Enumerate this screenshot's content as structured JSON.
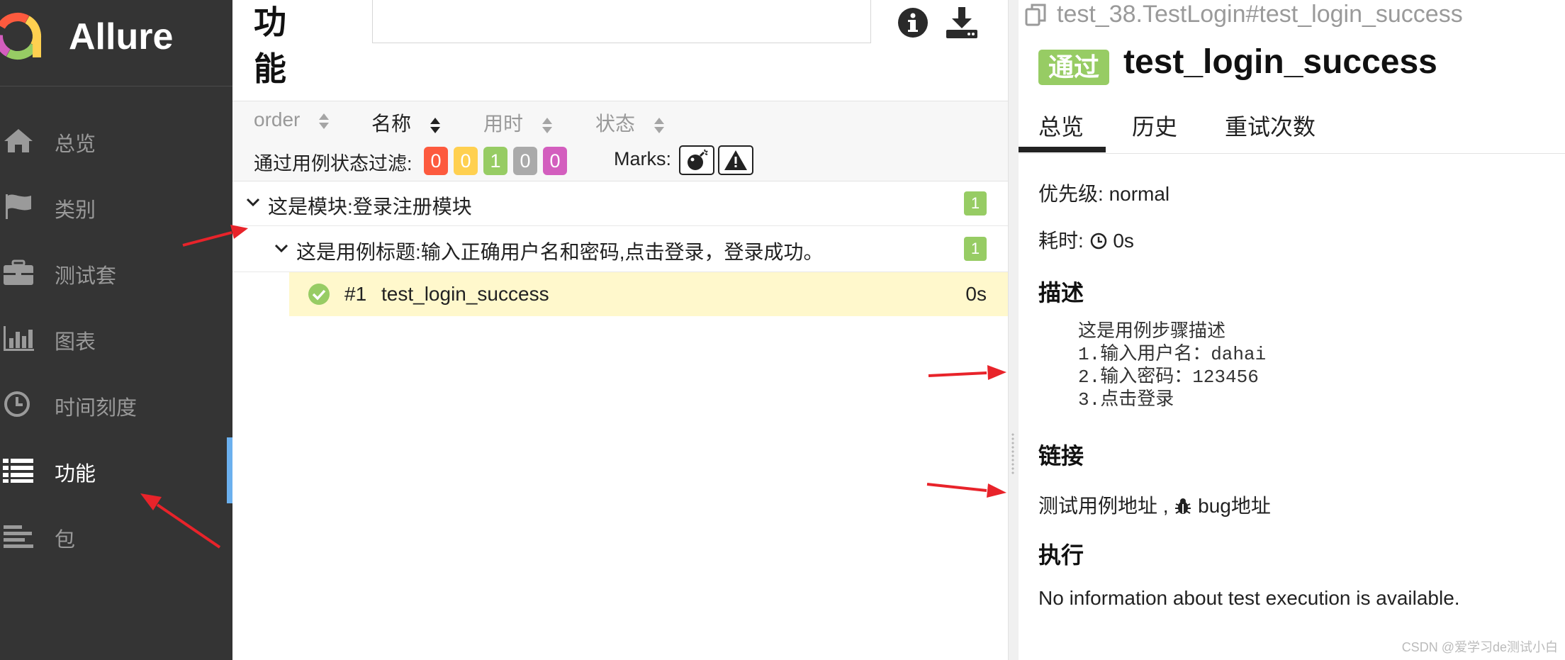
{
  "app": {
    "name": "Allure"
  },
  "sidebar": {
    "items": [
      {
        "label": "总览",
        "icon": "home-icon"
      },
      {
        "label": "类别",
        "icon": "flag-icon"
      },
      {
        "label": "测试套",
        "icon": "briefcase-icon"
      },
      {
        "label": "图表",
        "icon": "bar-chart-icon"
      },
      {
        "label": "时间刻度",
        "icon": "clock-icon"
      },
      {
        "label": "功能",
        "icon": "list-icon",
        "active": true
      },
      {
        "label": "包",
        "icon": "align-left-icon"
      }
    ]
  },
  "main": {
    "title": "功能",
    "search": {
      "value": "",
      "placeholder": ""
    },
    "toolbar": {
      "info_icon": "info-icon",
      "download_icon": "download-icon"
    },
    "sort": {
      "columns": [
        {
          "label": "order"
        },
        {
          "label": "名称",
          "active": true
        },
        {
          "label": "用时"
        },
        {
          "label": "状态"
        }
      ]
    },
    "filter": {
      "label": "通过用例状态过滤:",
      "counts": [
        {
          "status": "failed",
          "value": "0",
          "color": "#fd5a3e"
        },
        {
          "status": "broken",
          "value": "0",
          "color": "#ffd050"
        },
        {
          "status": "passed",
          "value": "1",
          "color": "#97cc64"
        },
        {
          "status": "skipped",
          "value": "0",
          "color": "#aaaaaa"
        },
        {
          "status": "unknown",
          "value": "0",
          "color": "#d35ebe"
        }
      ]
    },
    "marks": {
      "label": "Marks:",
      "icons": [
        "bomb-icon",
        "warning-icon"
      ]
    },
    "tree": {
      "module": {
        "label": "这是模块:登录注册模块",
        "count": "1"
      },
      "story": {
        "label": "这是用例标题:输入正确用户名和密码,点击登录，登录成功。",
        "count": "1"
      },
      "case": {
        "number": "#1",
        "name": "test_login_success",
        "duration": "0s"
      }
    }
  },
  "detail": {
    "breadcrumb": "test_38.TestLogin#test_login_success",
    "status": "通过",
    "title": "test_login_success",
    "tabs": [
      "总览",
      "历史",
      "重试次数"
    ],
    "priority": {
      "label": "优先级:",
      "value": "normal"
    },
    "duration": {
      "label": "耗时:",
      "value": "0s"
    },
    "description": {
      "heading": "描述",
      "lines": [
        "这是用例步骤描述",
        "1.输入用户名：dahai",
        "2.输入密码：123456",
        "3.点击登录"
      ]
    },
    "links": {
      "heading": "链接",
      "test_link": "测试用例地址",
      "separator": ",",
      "bug_link": "bug地址"
    },
    "execution": {
      "heading": "执行",
      "message": "No information about test execution is available."
    }
  },
  "watermark": "CSDN @爱学习de测试小白",
  "colors": {
    "sidebar_bg": "#343434",
    "active_accent": "#6bb0ee",
    "passed": "#97cc64",
    "highlight_row": "#fff8cc",
    "annotation_arrow": "#e8232a"
  }
}
